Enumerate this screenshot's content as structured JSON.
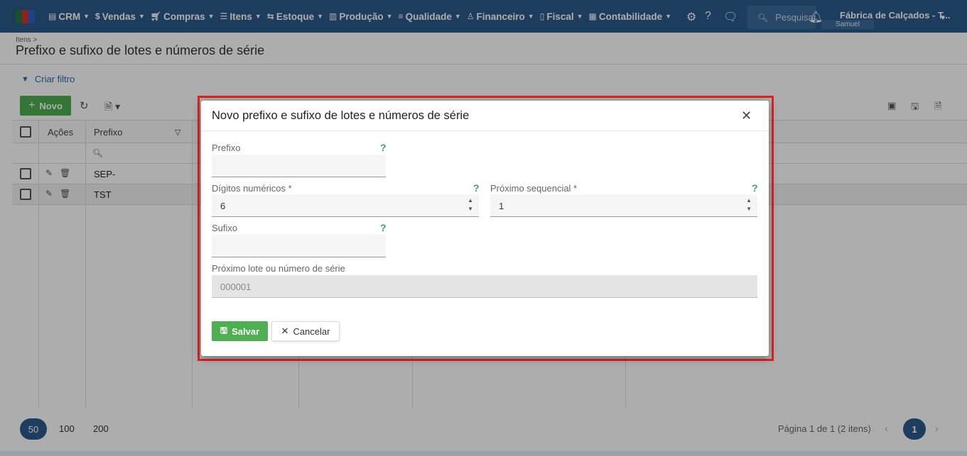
{
  "topbar": {
    "brand_colors": [
      "#1f7a3f",
      "#d63030",
      "#2a62c9"
    ],
    "nav": [
      {
        "icon": "crm-icon",
        "label": "CRM"
      },
      {
        "icon": "dollar-icon",
        "label": "Vendas"
      },
      {
        "icon": "cart-icon",
        "label": "Compras"
      },
      {
        "icon": "items-icon",
        "label": "Itens"
      },
      {
        "icon": "stock-icon",
        "label": "Estoque"
      },
      {
        "icon": "factory-icon",
        "label": "Produção"
      },
      {
        "icon": "quality-icon",
        "label": "Qualidade"
      },
      {
        "icon": "finance-icon",
        "label": "Financeiro"
      },
      {
        "icon": "fiscal-icon",
        "label": "Fiscal"
      },
      {
        "icon": "accounting-icon",
        "label": "Contabilidade"
      }
    ],
    "search_text": "Pesquisar ajuda",
    "company": "Fábrica de Calçados - T...",
    "user": "Samuel"
  },
  "page": {
    "breadcrumb": "Itens >",
    "title": "Prefixo e sufixo de lotes e números de série",
    "filter_label": "Criar filtro",
    "new_button": "Novo"
  },
  "grid": {
    "columns": {
      "actions": "Ações",
      "prefix": "Prefixo"
    },
    "rows": [
      {
        "prefix": "SEP-"
      },
      {
        "prefix": "TST"
      }
    ]
  },
  "pagination": {
    "sizes": [
      "50",
      "100",
      "200"
    ],
    "info": "Página 1 de 1 (2 itens)",
    "current": "1"
  },
  "modal": {
    "title": "Novo prefixo e sufixo de lotes e números de série",
    "prefix_label": "Prefixo",
    "prefix_value": "",
    "digits_label": "Dígitos numéricos *",
    "digits_value": "6",
    "next_seq_label": "Próximo sequencial *",
    "next_seq_value": "1",
    "suffix_label": "Sufixo",
    "suffix_value": "",
    "next_lot_label": "Próximo lote ou número de série",
    "next_lot_value": "000001",
    "help_mark": "?",
    "save_label": "Salvar",
    "cancel_label": "Cancelar"
  },
  "colors": {
    "primary": "#2b5a8c",
    "success": "#4caf50",
    "highlight": "#e02020",
    "help": "#3aa06a"
  }
}
